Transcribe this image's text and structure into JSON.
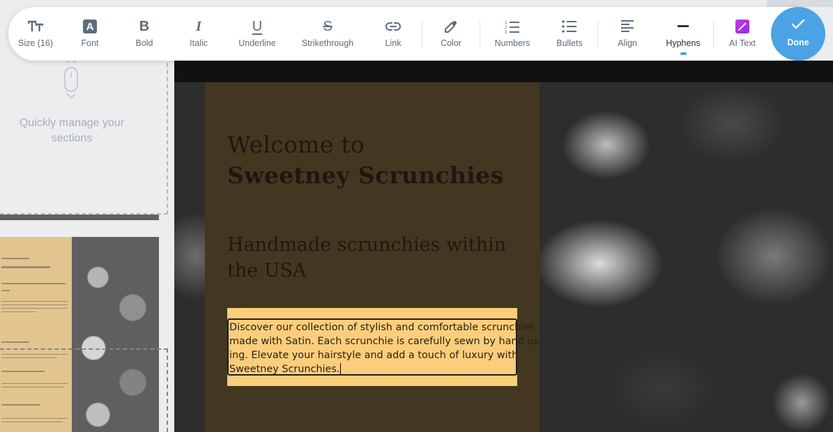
{
  "toolbar": {
    "items": [
      {
        "label": "Size (16)",
        "icon": "text-size-icon"
      },
      {
        "label": "Font",
        "icon": "font-icon",
        "glyph": "A"
      },
      {
        "label": "Bold",
        "icon": "bold-icon",
        "glyph": "B"
      },
      {
        "label": "Italic",
        "icon": "italic-icon",
        "glyph": "I"
      },
      {
        "label": "Underline",
        "icon": "underline-icon",
        "glyph": "U"
      },
      {
        "label": "Strikethrough",
        "icon": "strikethrough-icon",
        "glyph": "S"
      },
      {
        "label": "Link",
        "icon": "link-icon"
      },
      {
        "label": "Color",
        "icon": "eyedropper-icon"
      },
      {
        "label": "Numbers",
        "icon": "numbered-list-icon"
      },
      {
        "label": "Bullets",
        "icon": "bulleted-list-icon"
      },
      {
        "label": "Align",
        "icon": "align-left-icon"
      },
      {
        "label": "Hyphens",
        "icon": "hyphen-icon",
        "active": true
      },
      {
        "label": "AI Text",
        "icon": "ai-magic-icon"
      }
    ],
    "done_label": "Done",
    "accent_color": "#4aa3e4"
  },
  "left_panel": {
    "hint": "Quickly manage your sections"
  },
  "hero": {
    "welcome_line1": "Welcome to",
    "welcome_line2": "Sweetney Scrunchies",
    "subheading": "Handmade scrunchies within the USA",
    "body_lines": [
      "Discover our collection of stylish and comfortable scrunchies",
      "made with Satin. Each scrunchie is carefully sewn by hand us-",
      "ing. Elevate your hairstyle and add a touch of luxury with",
      "Sweetney Scrunchies."
    ],
    "panel_color": "#443722",
    "text_box_color": "#fcce7c"
  }
}
